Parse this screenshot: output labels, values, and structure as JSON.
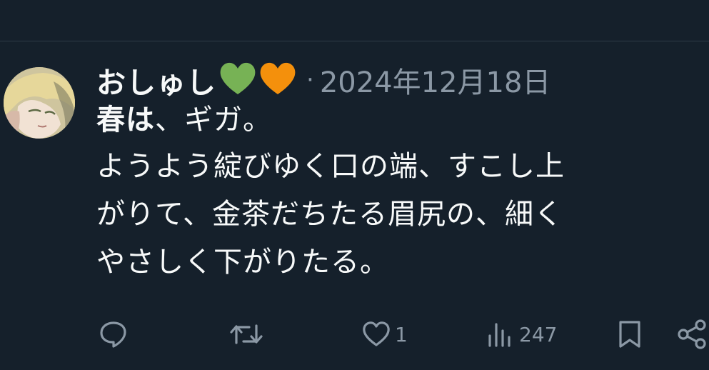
{
  "tweet": {
    "display_name": "おしゅし",
    "name_emojis": [
      "green-heart",
      "orange-heart"
    ],
    "separator": "·",
    "date": "2024年12月18日",
    "body_lines": [
      {
        "bold": "春は",
        "rest": "、ギガ。"
      },
      {
        "text": "ようよう綻びゆく口の端、すこし上"
      },
      {
        "text": "がりて、金茶だちたる眉尻の、細く"
      },
      {
        "text": "やさしく下がりたる。"
      }
    ]
  },
  "actions": {
    "reply": {
      "icon": "reply-icon",
      "count": ""
    },
    "retweet": {
      "icon": "retweet-icon",
      "count": ""
    },
    "like": {
      "icon": "heart-outline-icon",
      "count": "1"
    },
    "views": {
      "icon": "views-bar-chart-icon",
      "count": "247"
    },
    "bookmark": {
      "icon": "bookmark-icon",
      "count": ""
    },
    "share": {
      "icon": "share-icon",
      "count": ""
    }
  },
  "colors": {
    "background": "#15202b",
    "text_primary": "#f7f9f9",
    "text_secondary": "#8b98a5",
    "divider": "#2f3b47",
    "green_heart": "#77b255",
    "orange_heart": "#f4900c"
  }
}
